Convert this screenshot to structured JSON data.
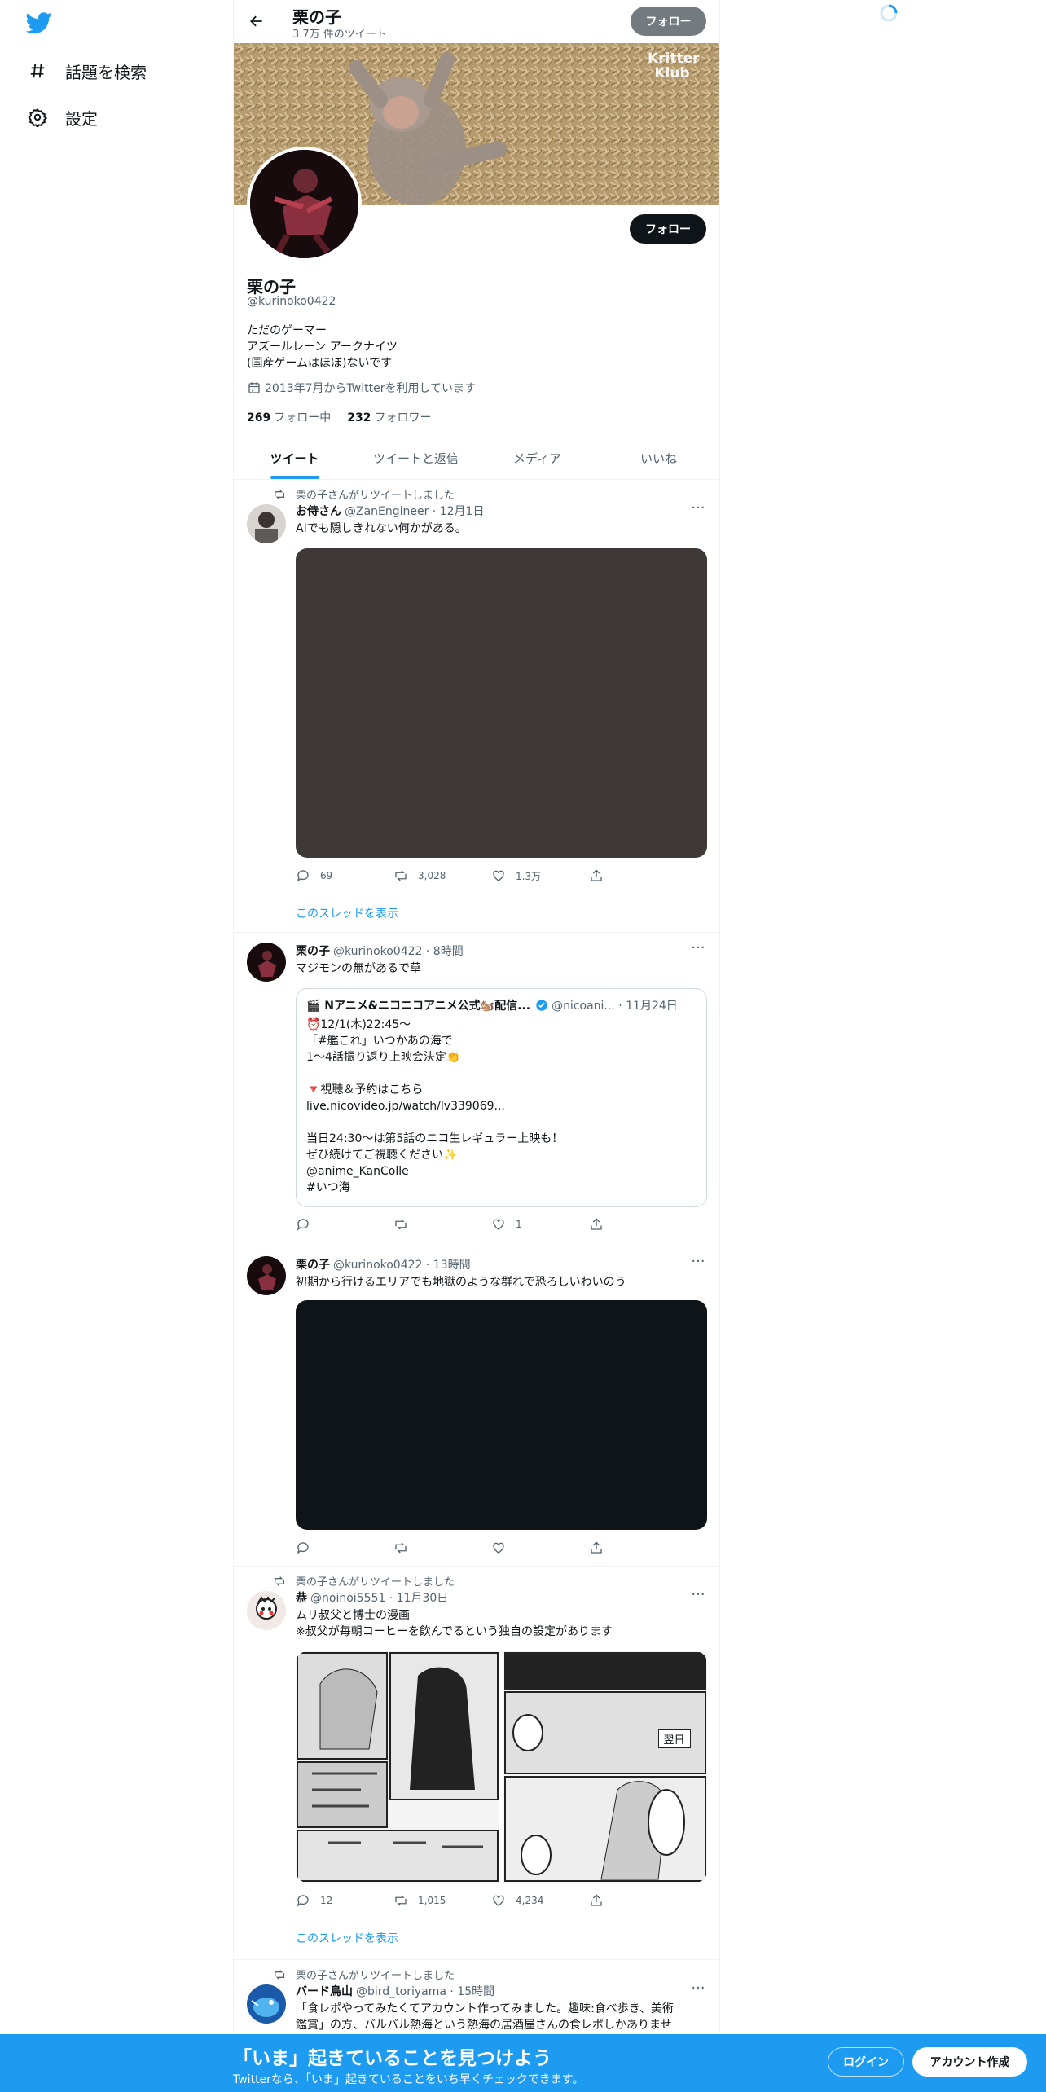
{
  "nav": {
    "items": [
      {
        "label": "話題を検索",
        "icon": "hashtag-icon"
      },
      {
        "label": "設定",
        "icon": "gear-icon"
      }
    ]
  },
  "header": {
    "title": "栗の子",
    "tweet_count": "3.7万 件のツイート",
    "follow_label": "フォロー"
  },
  "banner": {
    "watermark": "Kritter Klub"
  },
  "profile": {
    "name": "栗の子",
    "handle": "@kurinoko0422",
    "bio": [
      "ただのゲーマー",
      "アズールレーン アークナイツ",
      "(国産ゲームはほぼ)ないです"
    ],
    "joined": "2013年7月からTwitterを利用しています",
    "following_count": "269",
    "following_label": "フォロー中",
    "followers_count": "232",
    "followers_label": "フォロワー",
    "follow_label": "フォロー"
  },
  "tabs": [
    "ツイート",
    "ツイートと返信",
    "メディア",
    "いいね"
  ],
  "tweets": [
    {
      "retweeted_by": "栗の子さんがリツイートしました",
      "name": "お侍さん",
      "meta": "@ZanEngineer · 12月1日",
      "text": [
        "AIでも隠しきれない何かがある。"
      ],
      "replies": "69",
      "retweets": "3,028",
      "likes": "1.3万",
      "thread": "このスレッドを表示"
    },
    {
      "name": "栗の子",
      "meta": "@kurinoko0422 · 8時間",
      "text": [
        "マジモンの無があるで草"
      ],
      "quote": {
        "name": "🎬 Nアニメ&ニコニコアニメ公式🐿️配信...",
        "meta": "@nicoani... · 11月24日",
        "text": [
          "⏰12/1(木)22:45～",
          "「#艦これ」いつかあの海で",
          "1～4話振り返り上映会決定👏",
          "",
          "🔻視聴＆予約はこちら",
          "live.nicovideo.jp/watch/lv339069...",
          "",
          "当日24:30～は第5話のニコ生レギュラー上映も！",
          "ぜひ続けてご視聴ください✨",
          "@anime_KanColle",
          "#いつ海"
        ]
      },
      "likes": "1"
    },
    {
      "name": "栗の子",
      "meta": "@kurinoko0422 · 13時間",
      "text": [
        "初期から行けるエリアでも地獄のような群れで恐ろしいわいのう"
      ]
    },
    {
      "retweeted_by": "栗の子さんがリツイートしました",
      "name": "恭",
      "meta": "@noinoi5551 · 11月30日",
      "text": [
        "ムリ叔父と博士の漫画",
        "※叔父が毎朝コーヒーを飲んでるという独自の設定があります"
      ],
      "manga_label": "翌日",
      "replies": "12",
      "retweets": "1,015",
      "likes": "4,234",
      "thread": "このスレッドを表示"
    },
    {
      "retweeted_by": "栗の子さんがリツイートしました",
      "name": "バード鳥山",
      "meta": "@bird_toriyama · 15時間",
      "text": [
        "「食レポやってみたくてアカウント作ってみました。趣味:食べ歩き、美術",
        "鑑賞」の方、バルバル熱海という熱海の居酒屋さんの食レポしかありませ"
      ]
    }
  ],
  "bottom_bar": {
    "title": "「いま」起きていることを見つけよう",
    "subtitle": "Twitterなら、「いま」起きていることをいち早くチェックできます。",
    "login_label": "ログイン",
    "signup_label": "アカウント作成"
  },
  "colors": {
    "accent": "#1d9bf0",
    "text": "#0f1419",
    "muted": "#536471"
  }
}
